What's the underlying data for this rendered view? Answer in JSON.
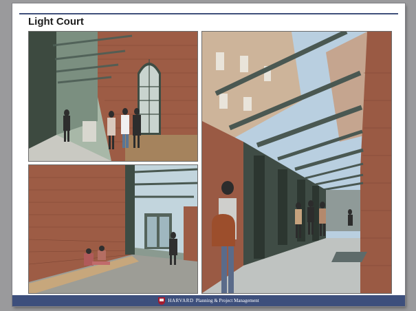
{
  "slide": {
    "title": "Light Court",
    "footer": {
      "logo": "shield-icon",
      "brand": "HARVARD",
      "department": "Planning & Project Management"
    }
  },
  "photos": [
    {
      "id": "courtyard-entrance-rendering"
    },
    {
      "id": "courtyard-bench-rendering"
    },
    {
      "id": "courtyard-skylight-corridor-rendering"
    }
  ],
  "colors": {
    "rule": "#3f4f7a",
    "footer": "#3d4f7c",
    "brick": "#9b5b45",
    "glass": "#bcd3e0"
  }
}
